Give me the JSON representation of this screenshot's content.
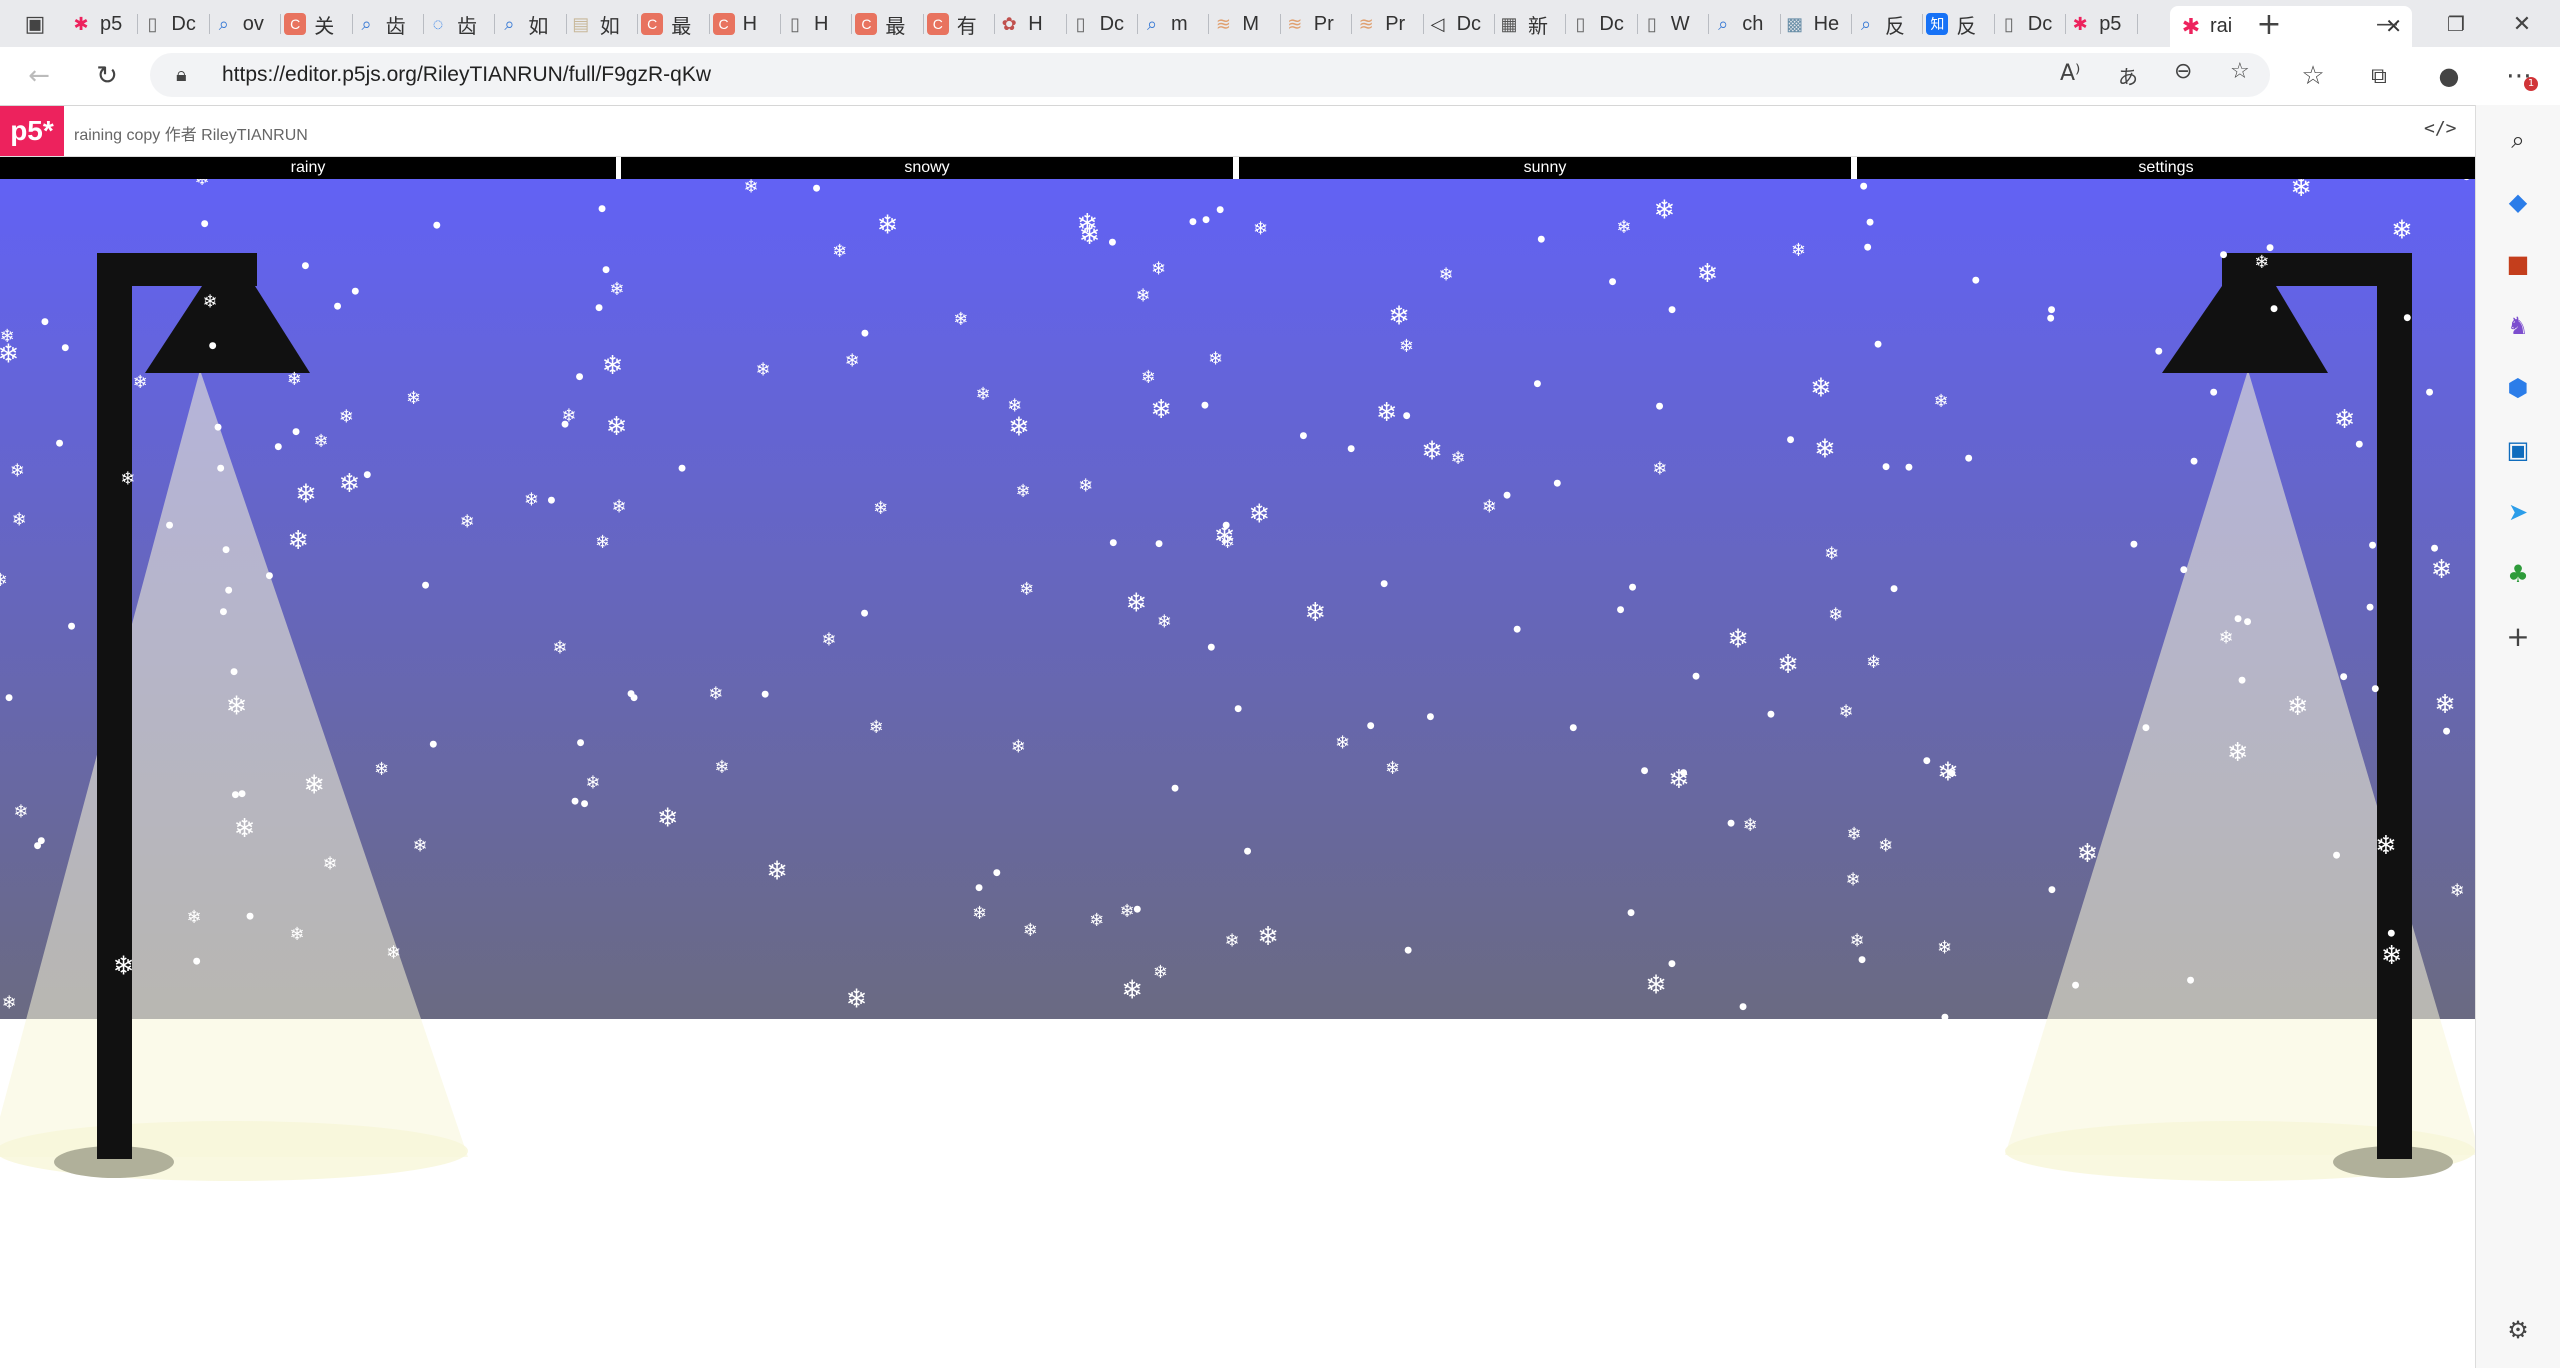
{
  "browser": {
    "tabs": [
      {
        "label": "p5",
        "icon": "p5-asterisk-icon",
        "color": "#ed225d"
      },
      {
        "label": "Dc",
        "icon": "document-icon",
        "color": "#666"
      },
      {
        "label": "ov",
        "icon": "search-icon",
        "color": "#3a7bd5"
      },
      {
        "label": "关",
        "icon": "c-logo-icon",
        "color": "#e8735f"
      },
      {
        "label": "齿",
        "icon": "search-icon",
        "color": "#3a7bd5"
      },
      {
        "label": "齿",
        "icon": "loading-icon",
        "color": "#2b7de9"
      },
      {
        "label": "如",
        "icon": "search-icon",
        "color": "#3a7bd5"
      },
      {
        "label": "如",
        "icon": "page-icon",
        "color": "#c8b89a"
      },
      {
        "label": "最",
        "icon": "c-logo-icon",
        "color": "#e8735f"
      },
      {
        "label": "H",
        "icon": "c-logo-icon",
        "color": "#e8735f"
      },
      {
        "label": "H",
        "icon": "document-icon",
        "color": "#666"
      },
      {
        "label": "最",
        "icon": "c-logo-icon",
        "color": "#e8735f"
      },
      {
        "label": "有",
        "icon": "c-logo-icon",
        "color": "#e8735f"
      },
      {
        "label": "H",
        "icon": "openai-icon",
        "color": "#c0504d"
      },
      {
        "label": "Dc",
        "icon": "document-icon",
        "color": "#666"
      },
      {
        "label": "m",
        "icon": "search-icon",
        "color": "#3a7bd5"
      },
      {
        "label": "M",
        "icon": "brain-icon",
        "color": "#e0a070"
      },
      {
        "label": "Pr",
        "icon": "brain-icon",
        "color": "#e0a070"
      },
      {
        "label": "Pr",
        "icon": "brain-icon",
        "color": "#e0a070"
      },
      {
        "label": "Dc",
        "icon": "speaker-icon",
        "color": "#333"
      },
      {
        "label": "新",
        "icon": "calendar-icon",
        "color": "#555"
      },
      {
        "label": "Dc",
        "icon": "document-icon",
        "color": "#666"
      },
      {
        "label": "W",
        "icon": "document-icon",
        "color": "#666"
      },
      {
        "label": "ch",
        "icon": "search-icon",
        "color": "#3a7bd5"
      },
      {
        "label": "He",
        "icon": "image-icon",
        "color": "#6a8fa8"
      },
      {
        "label": "反",
        "icon": "search-icon",
        "color": "#3a7bd5"
      },
      {
        "label": "反",
        "icon": "zhihu-icon",
        "color": "#1772f6"
      },
      {
        "label": "Dc",
        "icon": "document-icon",
        "color": "#666"
      },
      {
        "label": "p5",
        "icon": "p5-asterisk-icon",
        "color": "#ed225d"
      }
    ],
    "active_tab": {
      "label": "rai",
      "icon": "p5-asterisk-icon",
      "color": "#ed225d"
    },
    "url": "https://editor.p5js.org/RileyTIANRUN/full/F9gzR-qKw",
    "extension_badge": "1"
  },
  "p5": {
    "logo": "p5*",
    "sketch_title": "raining copy 作者 RileyTIANRUN",
    "code_icon": "</>"
  },
  "sketch": {
    "menu": [
      "rainy",
      "snowy",
      "sunny",
      "settings"
    ],
    "colors": {
      "sky_top": "#6262f5",
      "sky_bottom": "#6a6a82",
      "ground": "#ffffff",
      "lamp": "#111111",
      "light": "#f8f6d8",
      "snow": "#ffffff"
    },
    "snowflake_glyph": "❄"
  }
}
